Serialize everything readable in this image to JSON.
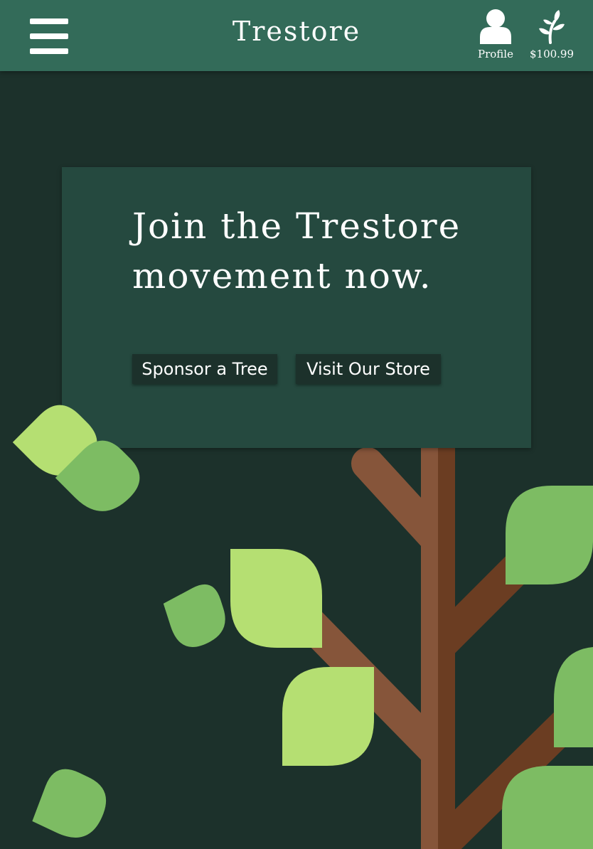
{
  "header": {
    "brand": "Trestore",
    "profile_label": "Profile",
    "balance_label": "$100.99"
  },
  "hero": {
    "title": "Join the Trestore movement now.",
    "sponsor_button": "Sponsor a Tree",
    "store_button": "Visit Our Store"
  },
  "colors": {
    "header_bg": "#336b59",
    "page_bg": "#1c312b",
    "card_bg": "#25493f",
    "trunk_light": "#86553a",
    "trunk_dark": "#6b3d22",
    "leaf_light": "#b5df72",
    "leaf_mid": "#7dbc63"
  },
  "icons": {
    "menu": "hamburger-menu-icon",
    "profile": "person-icon",
    "balance": "sprout-icon"
  }
}
